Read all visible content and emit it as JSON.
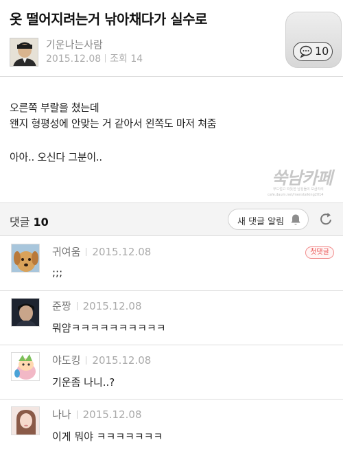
{
  "post": {
    "title": "옷 떨어지려는거 낚아채다가 실수로",
    "author": "기운나는사람",
    "date": "2015.12.08",
    "views": "조회 14",
    "comment_count": "10",
    "body": [
      "오른쪽 부랄을 쳤는데",
      "왠지 형평성에 안맞는 거 같아서 왼쪽도 마저 쳐줌",
      "",
      "아아.. 오신다 그분이.."
    ],
    "watermark": {
      "logo": "쑥남카페",
      "tagline": "부드럽고 따뜻한 남성들의 보금자리",
      "url": "cafe.daum.net/menstalking2014"
    }
  },
  "comments_bar": {
    "label": "댓글",
    "count": "10",
    "alert_button_label": "새 댓글 알림"
  },
  "comments": [
    {
      "author": "귀여움",
      "date": "2015.12.08",
      "text": ";;;",
      "badge": "첫댓글"
    },
    {
      "author": "준짱",
      "date": "2015.12.08",
      "text": "뭐얌ㅋㅋㅋㅋㅋㅋㅋㅋㅋㅋ",
      "badge": ""
    },
    {
      "author": "야도킹",
      "date": "2015.12.08",
      "text": "기운좀 나니..?",
      "badge": ""
    },
    {
      "author": "나나",
      "date": "2015.12.08",
      "text": "이게 뭐야 ㅋㅋㅋㅋㅋㅋㅋ",
      "badge": ""
    }
  ],
  "colors": {
    "badge_red": "#e8504f",
    "divider": "#dcdcdc",
    "meta_gray": "#aaaaaa"
  },
  "icons": [
    "speech-bubble-icon",
    "bell-icon",
    "refresh-icon"
  ]
}
